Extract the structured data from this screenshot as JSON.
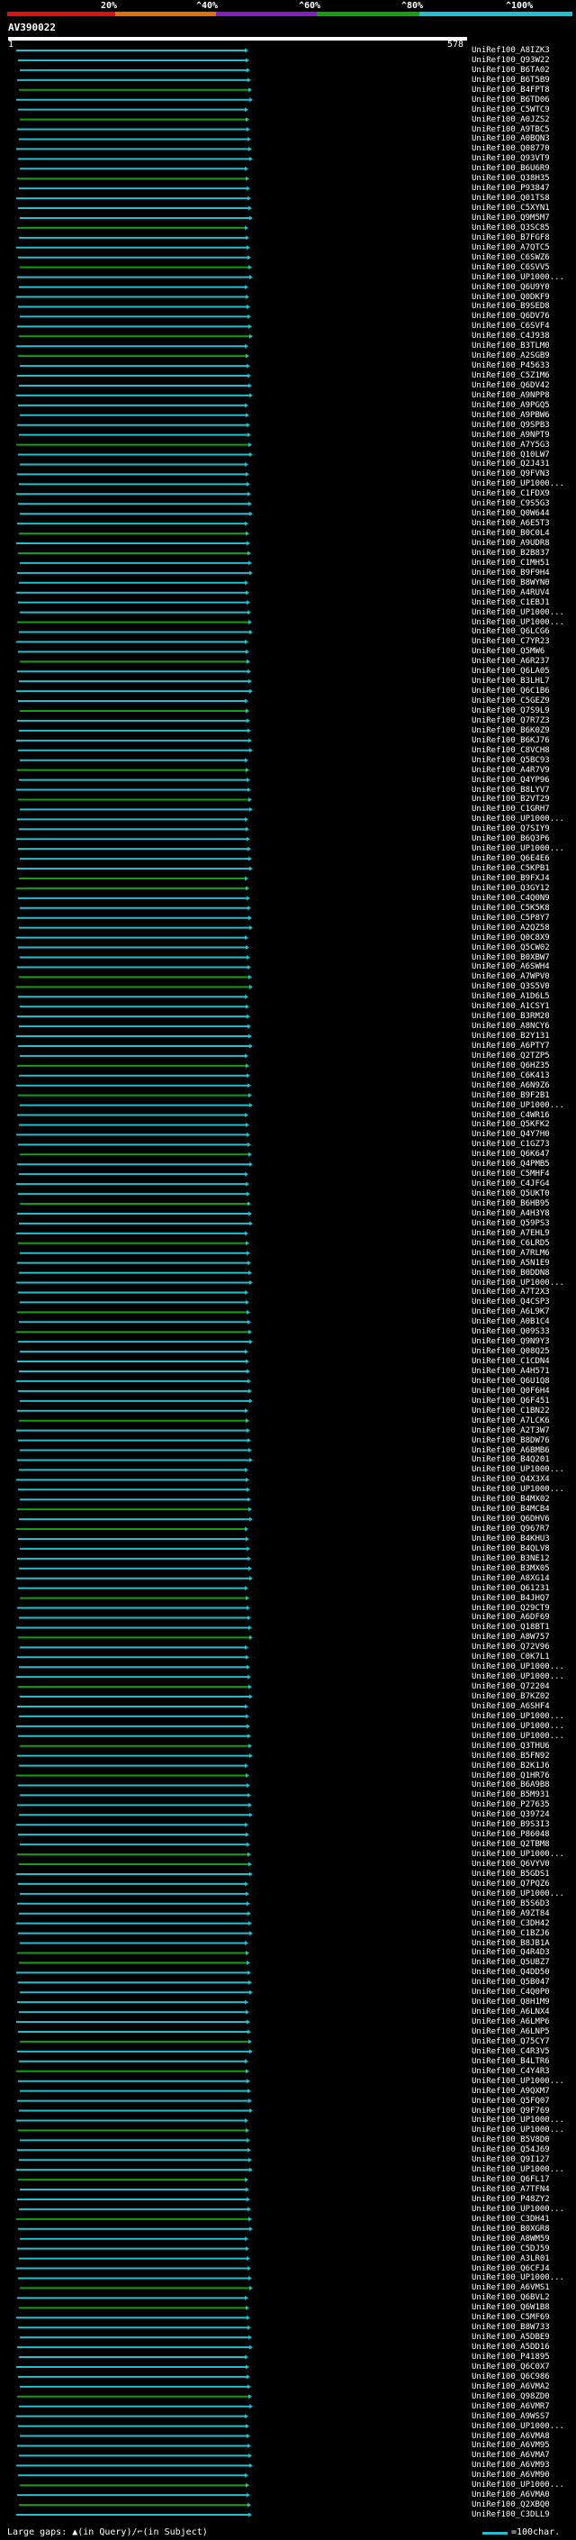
{
  "scale": {
    "labels": [
      "20%",
      "^40%",
      "^60%",
      "^80%",
      "^100%"
    ],
    "colors": [
      "#e01010",
      "#e07010",
      "#8020c0",
      "#10a010",
      "#20c0d0"
    ]
  },
  "query": {
    "id": "AV390022",
    "start": "1",
    "end": "578"
  },
  "footer": {
    "large_gaps_text": "Large gaps: ▲(in Query)/⌐(in Subject)",
    "legend_text": "=100char.",
    "legend_color": "#20c0d0"
  },
  "hit_colors": {
    "main": "#20c0d0",
    "alt": "#10a010"
  },
  "hits": [
    "UniRef100_A8IZK3",
    "UniRef100_Q93W22",
    "UniRef100_B6TA02",
    "UniRef100_B6T5B9",
    "UniRef100_B4FPT8",
    "UniRef100_B6TD06",
    "UniRef100_C5WTC9",
    "UniRef100_A0JZS2",
    "UniRef100_A9TBC5",
    "UniRef100_A0BQN3",
    "UniRef100_Q08770",
    "UniRef100_Q93VT9",
    "UniRef100_B6U6R9",
    "UniRef100_Q38H35",
    "UniRef100_P93847",
    "UniRef100_Q01TS8",
    "UniRef100_C5XYN1",
    "UniRef100_Q9M5M7",
    "UniRef100_Q3SC85",
    "UniRef100_B7FGF8",
    "UniRef100_A7QTC5",
    "UniRef100_C6SWZ6",
    "UniRef100_C6SVV5",
    "UniRef100_UP1000...",
    "UniRef100_Q6U9Y0",
    "UniRef100_Q0DKF9",
    "UniRef100_B9SED8",
    "UniRef100_Q6DV76",
    "UniRef100_C6SVF4",
    "UniRef100_C4J938",
    "UniRef100_B3TLM0",
    "UniRef100_A2SGB9",
    "UniRef100_P45633",
    "UniRef100_C5Z1M6",
    "UniRef100_Q6DV42",
    "UniRef100_A9NPP8",
    "UniRef100_A9PGQ5",
    "UniRef100_A9PBW6",
    "UniRef100_Q9SPB3",
    "UniRef100_A9NPT9",
    "UniRef100_A7Y5G3",
    "UniRef100_Q10LW7",
    "UniRef100_Q2J431",
    "UniRef100_Q9FVN3",
    "UniRef100_UP1000...",
    "UniRef100_C1FDX9",
    "UniRef100_C9S5G3",
    "UniRef100_Q0W644",
    "UniRef100_A6E5T3",
    "UniRef100_B0C0L4",
    "UniRef100_A9UDR8",
    "UniRef100_B2B837",
    "UniRef100_C1MH51",
    "UniRef100_B9F9H4",
    "UniRef100_B8WYN0",
    "UniRef100_A4RUV4",
    "UniRef100_C1EBJ1",
    "UniRef100_UP1000...",
    "UniRef100_UP1000...",
    "UniRef100_Q6LCG6",
    "UniRef100_C7YR23",
    "UniRef100_Q5MW6",
    "UniRef100_A6R237",
    "UniRef100_Q6LA05",
    "UniRef100_B3LHL7",
    "UniRef100_Q6C1B6",
    "UniRef100_C5GEZ9",
    "UniRef100_Q7S9L9",
    "UniRef100_Q7R7Z3",
    "UniRef100_B6K0Z9",
    "UniRef100_B6KJ76",
    "UniRef100_C8VCH8",
    "UniRef100_Q5BC93",
    "UniRef100_A4R7V9",
    "UniRef100_Q4YP96",
    "UniRef100_B8LYV7",
    "UniRef100_B2VT29",
    "UniRef100_C1GRH7",
    "UniRef100_UP1000...",
    "UniRef100_Q7SIY9",
    "UniRef100_B6Q3P6",
    "UniRef100_UP1000...",
    "UniRef100_Q6E4E6",
    "UniRef100_C5KPB1",
    "UniRef100_B9FXJ4",
    "UniRef100_Q3GY12",
    "UniRef100_C4Q0N9",
    "UniRef100_C5K5K8",
    "UniRef100_C5P8Y7",
    "UniRef100_A2QZ58",
    "UniRef100_Q0C8X9",
    "UniRef100_Q5CW02",
    "UniRef100_B0XBW7",
    "UniRef100_A6SWH4",
    "UniRef100_A7WPV0",
    "UniRef100_Q3S5V0",
    "UniRef100_A1D6L5",
    "UniRef100_A1CSY1",
    "UniRef100_B3RM20",
    "UniRef100_A8NCY6",
    "UniRef100_B2Y131",
    "UniRef100_A6PTY7",
    "UniRef100_Q2TZP5",
    "UniRef100_Q6HZ35",
    "UniRef100_C6K413",
    "UniRef100_A6N9Z6",
    "UniRef100_B9F2B1",
    "UniRef100_UP1000...",
    "UniRef100_C4WR16",
    "UniRef100_Q5KFK2",
    "UniRef100_Q4Y7H0",
    "UniRef100_C1GZ73",
    "UniRef100_Q6K647",
    "UniRef100_Q4PMB5",
    "UniRef100_C5MHF4",
    "UniRef100_C4JFG4",
    "UniRef100_Q5UKT0",
    "UniRef100_B6HB95",
    "UniRef100_A4H3Y8",
    "UniRef100_Q59PS3",
    "UniRef100_A7EHL9",
    "UniRef100_C6LRD5",
    "UniRef100_A7RLM6",
    "UniRef100_A5N1E9",
    "UniRef100_B0DDN8",
    "UniRef100_UP1000...",
    "UniRef100_A7T2X3",
    "UniRef100_Q4CSP3",
    "UniRef100_A6L9K7",
    "UniRef100_A0B1C4",
    "UniRef100_Q09S33",
    "UniRef100_Q9N9Y3",
    "UniRef100_Q08Q25",
    "UniRef100_C1CDN4",
    "UniRef100_A4H571",
    "UniRef100_Q6U1Q8",
    "UniRef100_Q0F6H4",
    "UniRef100_Q6F451",
    "UniRef100_C1BN22",
    "UniRef100_A7LCK6",
    "UniRef100_A2T3W7",
    "UniRef100_B8DW76",
    "UniRef100_A6BMB6",
    "UniRef100_B4Q201",
    "UniRef100_UP1000...",
    "UniRef100_Q4X3X4",
    "UniRef100_UP1000...",
    "UniRef100_B4MX02",
    "UniRef100_B4MCB4",
    "UniRef100_Q6DHV6",
    "UniRef100_Q967R7",
    "UniRef100_B4KHU3",
    "UniRef100_B4QLV8",
    "UniRef100_B3NE12",
    "UniRef100_B3MX05",
    "UniRef100_A8XG14",
    "UniRef100_Q61231",
    "UniRef100_B4JHQ7",
    "UniRef100_Q29CT9",
    "UniRef100_A6DF69",
    "UniRef100_Q18BT1",
    "UniRef100_A8W757",
    "UniRef100_Q72V96",
    "UniRef100_C0K7L1",
    "UniRef100_UP1000...",
    "UniRef100_UP1000...",
    "UniRef100_Q72204",
    "UniRef100_B7KZ02",
    "UniRef100_A6SHF4",
    "UniRef100_UP1000...",
    "UniRef100_UP1000...",
    "UniRef100_UP1000...",
    "UniRef100_Q3THU6",
    "UniRef100_B5FN92",
    "UniRef100_B2K1J6",
    "UniRef100_Q1HR76",
    "UniRef100_B6A9B8",
    "UniRef100_B5M931",
    "UniRef100_P27635",
    "UniRef100_Q39724",
    "UniRef100_B9S3I3",
    "UniRef100_P86048",
    "UniRef100_Q2TBM8",
    "UniRef100_UP1000...",
    "UniRef100_Q6VYV0",
    "UniRef100_B5GDS1",
    "UniRef100_Q7PQZ6",
    "UniRef100_UP1000...",
    "UniRef100_B5S6D3",
    "UniRef100_A9ZT84",
    "UniRef100_C3DH42",
    "UniRef100_C1BZJ6",
    "UniRef100_B8JB1A",
    "UniRef100_Q4R4D3",
    "UniRef100_Q5UBZ7",
    "UniRef100_Q4DD50",
    "UniRef100_Q5B047",
    "UniRef100_C4Q0P0",
    "UniRef100_Q8H1M9",
    "UniRef100_A6LNX4",
    "UniRef100_A6LMP6",
    "UniRef100_A6LNP5",
    "UniRef100_Q75CY7",
    "UniRef100_C4R3V5",
    "UniRef100_B4LTR6",
    "UniRef100_C4Y4R3",
    "UniRef100_UP1000...",
    "UniRef100_A9QXM7",
    "UniRef100_Q5FQ07",
    "UniRef100_Q9F769",
    "UniRef100_UP1000...",
    "UniRef100_UP1000...",
    "UniRef100_B5V8D0",
    "UniRef100_Q54J69",
    "UniRef100_Q9I127",
    "UniRef100_UP1000...",
    "UniRef100_Q6FL17",
    "UniRef100_A7TFN4",
    "UniRef100_P48ZY2",
    "UniRef100_UP1000...",
    "UniRef100_C3DH41",
    "UniRef100_B0XGR8",
    "UniRef100_A8WM59",
    "UniRef100_C5DJ59",
    "UniRef100_A3LR01",
    "UniRef100_Q6CFJ4",
    "UniRef100_UP1000...",
    "UniRef100_A6VMS1",
    "UniRef100_Q6BVL2",
    "UniRef100_Q6W1B8",
    "UniRef100_C5MF69",
    "UniRef100_B8W733",
    "UniRef100_A5DBE9",
    "UniRef100_A5DD16",
    "UniRef100_P41895",
    "UniRef100_Q6C0X7",
    "UniRef100_Q6C986",
    "UniRef100_A6VMA2",
    "UniRef100_Q98ZD0",
    "UniRef100_A6VMR7",
    "UniRef100_A9WSS7",
    "UniRef100_UP1000...",
    "UniRef100_A6VMA8",
    "UniRef100_A6VM95",
    "UniRef100_A6VMA7",
    "UniRef100_A6VM93",
    "UniRef100_A6VM90",
    "UniRef100_UP1000...",
    "UniRef100_A6VMA0",
    "UniRef100_Q2XBQ0",
    "UniRef100_C3DLL9"
  ]
}
